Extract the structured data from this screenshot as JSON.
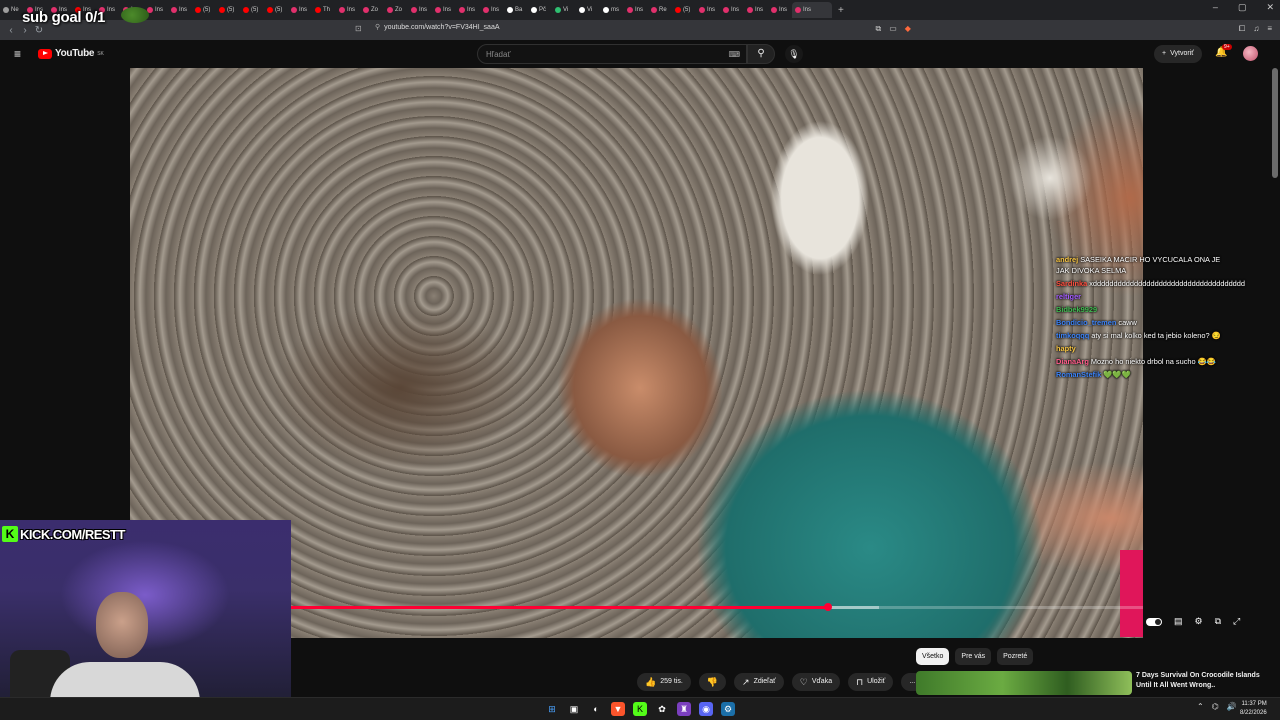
{
  "browser": {
    "tabs": [
      {
        "label": "Ne",
        "color": "#9e9e9e"
      },
      {
        "label": "Ins",
        "color": "#e1306c"
      },
      {
        "label": "Ins",
        "color": "#e1306c"
      },
      {
        "label": "Ins",
        "color": "#ff0000"
      },
      {
        "label": "Ins",
        "color": "#e1306c"
      },
      {
        "label": "Ins",
        "color": "#e1306c"
      },
      {
        "label": "Ins",
        "color": "#e1306c"
      },
      {
        "label": "Ins",
        "color": "#e1306c"
      },
      {
        "label": "(5)",
        "color": "#ff0000"
      },
      {
        "label": "(5)",
        "color": "#ff0000"
      },
      {
        "label": "(5)",
        "color": "#ff0000"
      },
      {
        "label": "(5)",
        "color": "#ff0000"
      },
      {
        "label": "Ins",
        "color": "#e1306c"
      },
      {
        "label": "Th",
        "color": "#ff0000"
      },
      {
        "label": "Ins",
        "color": "#e1306c"
      },
      {
        "label": "Zo",
        "color": "#e1306c"
      },
      {
        "label": "Zo",
        "color": "#e1306c"
      },
      {
        "label": "Ins",
        "color": "#e1306c"
      },
      {
        "label": "Ins",
        "color": "#e1306c"
      },
      {
        "label": "Ins",
        "color": "#e1306c"
      },
      {
        "label": "Ins",
        "color": "#e1306c"
      },
      {
        "label": "Ba",
        "color": "#ffffff"
      },
      {
        "label": "Pč",
        "color": "#ffffff"
      },
      {
        "label": "Vi",
        "color": "#2fbf71"
      },
      {
        "label": "Vi",
        "color": "#ffffff"
      },
      {
        "label": "ms",
        "color": "#ffffff"
      },
      {
        "label": "Ins",
        "color": "#e1306c"
      },
      {
        "label": "Re",
        "color": "#e1306c"
      },
      {
        "label": "(5)",
        "color": "#ff0000"
      },
      {
        "label": "Ins",
        "color": "#e1306c"
      },
      {
        "label": "Ins",
        "color": "#e1306c"
      },
      {
        "label": "Ins",
        "color": "#e1306c"
      },
      {
        "label": "Ins",
        "color": "#e1306c"
      },
      {
        "label": "Ins",
        "color": "#e1306c"
      }
    ],
    "url": "youtube.com/watch?v=FV34HI_saaA"
  },
  "youtube": {
    "logo_text": "YouTube",
    "logo_region": "SK",
    "search_placeholder": "Hľadať",
    "create_label": "Vytvoriť",
    "notif_badge": "9+"
  },
  "overlay": {
    "sub_goal": "sub goal 0/1",
    "kick_label": "KICK.COM/RESTT"
  },
  "chat": [
    {
      "user": "andrej",
      "user_color": "#f7c543",
      "text": "SASEIKA MACIR HO VYCUCALA ONA JE JAK DIVOKA SELMA"
    },
    {
      "user": "Sardinka",
      "user_color": "#ff4f3f",
      "text": "xddddddddddddddddddddddddddddddddddddd"
    },
    {
      "user": "reltiger",
      "user_color": "#a35cff",
      "text": ""
    },
    {
      "user": "Bidbek9929",
      "user_color": "#3fb950",
      "text": ""
    },
    {
      "user": "Bondicio_tremen",
      "user_color": "#3b82f6",
      "text": "caww"
    },
    {
      "user": "timkoqqq",
      "user_color": "#3b82f6",
      "text": "aty si mal kolko ked ta jebio koleno? 😏"
    },
    {
      "user": "hapty",
      "user_color": "#f7c543",
      "text": ""
    },
    {
      "user": "DianaArg",
      "user_color": "#ff5c8a",
      "text": "Mozno ho niekto drbol na sucho 😂😂"
    },
    {
      "user": "RomanStefik",
      "user_color": "#3b82f6",
      "text": "💚💚💚"
    }
  ],
  "player": {
    "progress_played_fraction": 0.63,
    "progress_loaded_fraction": 0.69
  },
  "actions": {
    "like_count": "259 tis.",
    "share_label": "Zdieľať",
    "thanks_label": "Vďaka",
    "save_label": "Uložiť",
    "more_label": "..."
  },
  "filter_chips": [
    "Všetko",
    "Pre vás",
    "Pozreté"
  ],
  "recommendation": {
    "title": "7 Days Survival On Crocodile Islands Until It All Went Wrong.."
  },
  "taskbar": {
    "time": "11:37 PM",
    "date": "8/22/2026"
  }
}
